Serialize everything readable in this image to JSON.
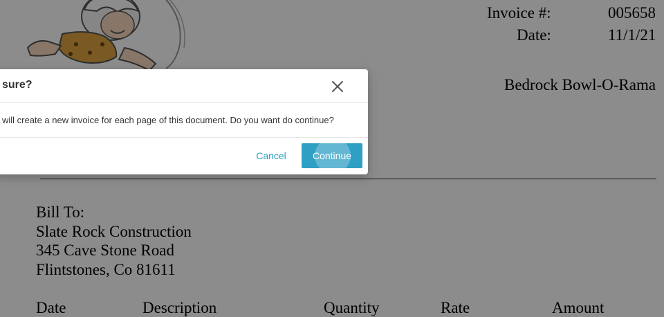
{
  "invoice": {
    "number_label": "Invoice #:",
    "number_value": "005658",
    "date_label": "Date:",
    "date_value": "11/1/21",
    "company": "Bedrock Bowl-O-Rama",
    "bill_to": {
      "heading": "Bill To:",
      "name": "Slate Rock Construction",
      "address1": "345 Cave Stone Road",
      "address2": "Flintstones, Co 81611"
    },
    "columns": [
      "Date",
      "Description",
      "Quantity",
      "Rate",
      "Amount"
    ]
  },
  "modal": {
    "title": "sure?",
    "message": "will create a new invoice for each page of this document. Do you want do continue?",
    "cancel_label": "Cancel",
    "continue_label": "Continue",
    "close_icon": "close-icon"
  },
  "colors": {
    "accent": "#2f9fc4",
    "link": "#2b9fc6",
    "overlay": "rgba(0,0,0,0.45)"
  }
}
